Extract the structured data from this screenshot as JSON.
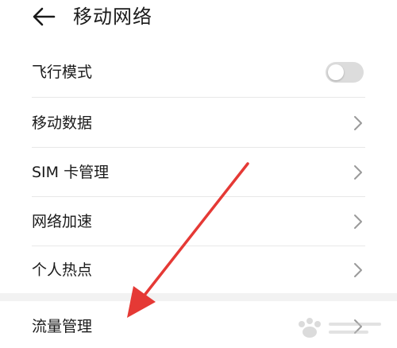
{
  "header": {
    "title": "移动网络",
    "back_icon": "arrow-left-icon"
  },
  "settings": {
    "items": [
      {
        "label": "飞行模式",
        "control": "toggle",
        "toggle_state": "off"
      },
      {
        "label": "移动数据",
        "control": "chevron"
      },
      {
        "label": "SIM 卡管理",
        "control": "chevron"
      },
      {
        "label": "网络加速",
        "control": "chevron"
      },
      {
        "label": "个人热点",
        "control": "chevron"
      },
      {
        "label": "流量管理",
        "control": "chevron"
      }
    ]
  },
  "annotation": {
    "arrow_color": "#e53935"
  },
  "colors": {
    "text": "#1a1a1a",
    "chevron": "#9a9a9a",
    "toggle_off": "#dcdcdc",
    "divider": "#e8e8e8",
    "section_gap": "#f2f2f2"
  }
}
